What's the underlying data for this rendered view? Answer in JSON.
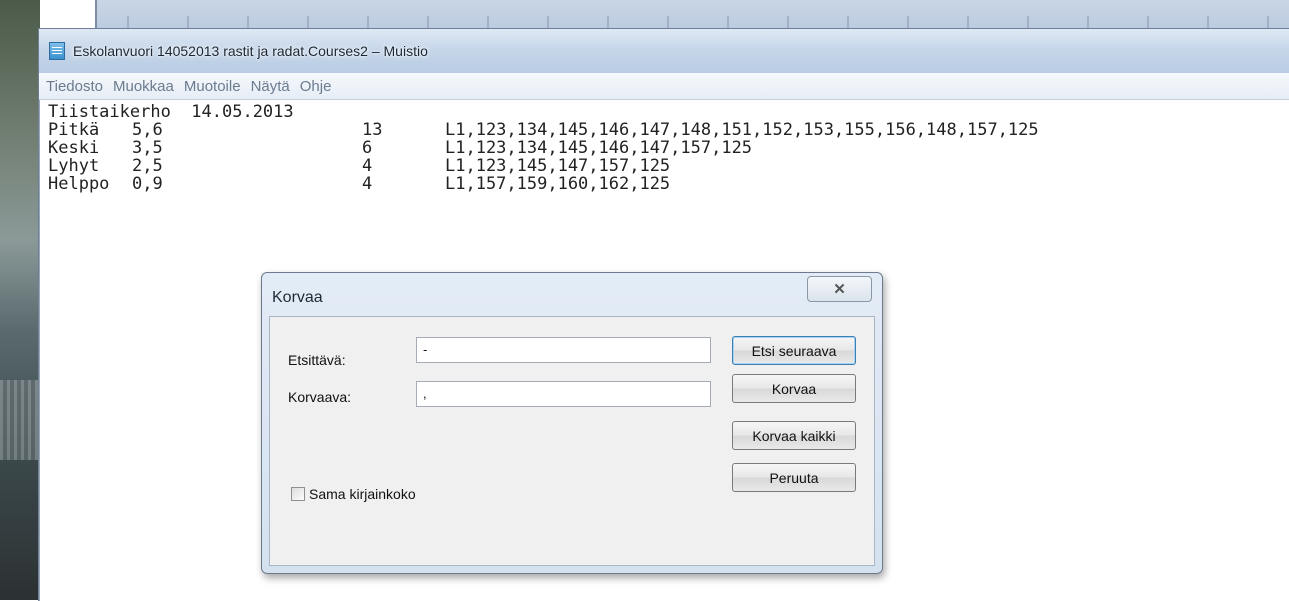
{
  "window": {
    "title": "Eskolanvuori 14052013 rastit ja radat.Courses2 – Muistio"
  },
  "menu": [
    "Tiedosto",
    "Muokkaa",
    "Muotoile",
    "Näytä",
    "Ohje"
  ],
  "editor": {
    "header": "Tiistaikerho  14.05.2013",
    "rows": [
      {
        "name": "Pitkä",
        "length": "5,6",
        "count": "13",
        "controls": "L1,123,134,145,146,147,148,151,152,153,155,156,148,157,125"
      },
      {
        "name": "Keski",
        "length": "3,5",
        "count": "6",
        "controls": "L1,123,134,145,146,147,157,125"
      },
      {
        "name": "Lyhyt",
        "length": "2,5",
        "count": "4",
        "controls": "L1,123,145,147,157,125"
      },
      {
        "name": "Helppo",
        "length": "0,9",
        "count": "4",
        "controls": "L1,157,159,160,162,125"
      }
    ]
  },
  "dialog": {
    "title": "Korvaa",
    "find_label": "Etsittävä:",
    "find_value": "-",
    "replace_label": "Korvaava:",
    "replace_value": ",",
    "find_next_label": "Etsi seuraava",
    "replace_button_label": "Korvaa",
    "replace_all_label": "Korvaa kaikki",
    "cancel_label": "Peruuta",
    "match_case_label": "Sama kirjainkoko",
    "match_case_checked": false
  }
}
